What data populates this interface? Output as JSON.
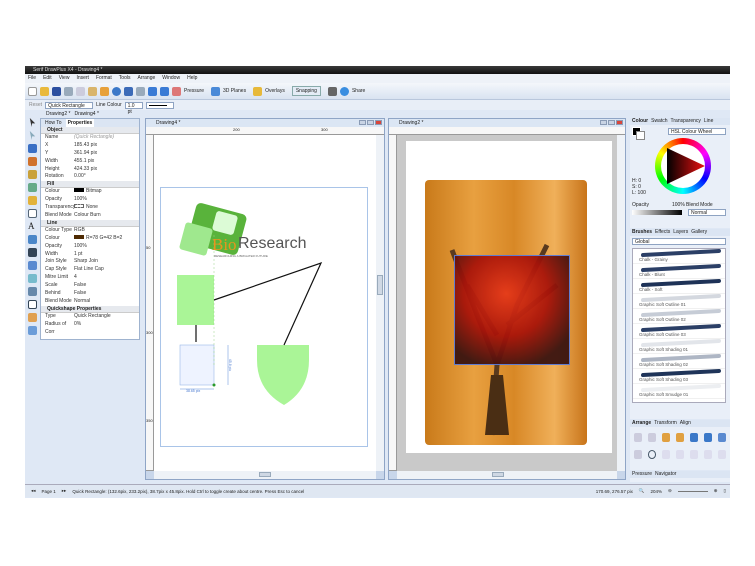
{
  "app": {
    "title": "Serif DrawPlus X4 - Drawing4 *"
  },
  "menu": [
    "File",
    "Edit",
    "View",
    "Insert",
    "Format",
    "Tools",
    "Arrange",
    "Window",
    "Help"
  ],
  "toolbar": {
    "pressure": "Pressure",
    "planes": "3D Planes",
    "overlays": "Overlays",
    "snapping": "Snapping",
    "share": "Share"
  },
  "context": {
    "reset": "Reset",
    "shape": "Quick Rectangle",
    "line_colour": "Line Colour",
    "line_width": "1.0 pt"
  },
  "doc_tabs": [
    "Drawing2 *",
    "Drawing4 *"
  ],
  "props": {
    "tabs": [
      "How To",
      "Properties"
    ],
    "sections": [
      {
        "title": "Object",
        "rows": [
          [
            "Name",
            "(Quick Rectangle)"
          ],
          [
            "X",
            "185.43 pix"
          ],
          [
            "Y",
            "361.94 pix"
          ],
          [
            "Width",
            "455.1 pix"
          ],
          [
            "Height",
            "424.33 pix"
          ],
          [
            "Rotation",
            "0.00°"
          ]
        ]
      },
      {
        "title": "Fill",
        "rows": [
          [
            "Colour",
            "Bitmap"
          ],
          [
            "Opacity",
            "100%"
          ],
          [
            "Transparency",
            "None"
          ],
          [
            "Blend Mode",
            "Colour Burn"
          ]
        ]
      },
      {
        "title": "Line",
        "rows": [
          [
            "Colour Type",
            "RGB"
          ],
          [
            "Colour",
            "R=78 G=42 B=2"
          ],
          [
            "Opacity",
            "100%"
          ],
          [
            "Width",
            "1 pt"
          ],
          [
            "Join Style",
            "Sharp Join"
          ],
          [
            "Cap Style",
            "Flat Line Cap"
          ],
          [
            "Mitre Limit",
            "4"
          ],
          [
            "Scale",
            "False"
          ],
          [
            "Behind",
            "False"
          ],
          [
            "Blend Mode",
            "Normal"
          ]
        ]
      },
      {
        "title": "Quickshape Properties",
        "rows": [
          [
            "Type",
            "Quick Rectangle"
          ],
          [
            "Radius of Corr",
            "0%"
          ]
        ]
      }
    ]
  },
  "doc_left": {
    "title": "Drawing4 *",
    "ruler_top": [
      "200",
      "300"
    ],
    "ruler_left": [
      "50",
      "300",
      "350"
    ],
    "logo_bio": "Bio",
    "logo_research": "Research",
    "logo_tagline": "RESEARCHING A BRIGHTER FUTURE",
    "dim_w": "38.65 pix",
    "dim_h": "45.8 pix"
  },
  "doc_right": {
    "title": "Drawing2 *"
  },
  "colour_panel": {
    "tabs": [
      "Colour",
      "Swatch",
      "Transparency",
      "Line"
    ],
    "mode": "HSL Colour Wheel",
    "h": "H: 0",
    "s": "S: 0",
    "l": "L: 100",
    "opacity_label": "Opacity",
    "opacity": "100%",
    "blend_label": "Blend Mode",
    "blend": "Normal"
  },
  "brushes_panel": {
    "tabs": [
      "Brushes",
      "Effects",
      "Layers",
      "Gallery"
    ],
    "category": "Global",
    "items": [
      {
        "name": "Chalk - Grainy",
        "color": "#2b3f66"
      },
      {
        "name": "Chalk - Blunt",
        "color": "#2b3f66"
      },
      {
        "name": "Chalk - Soft",
        "color": "#1e3257"
      },
      {
        "name": "Graphic Soft Outline 01",
        "color": "#d4d8df"
      },
      {
        "name": "Graphic Soft Outline 02",
        "color": "#c6ccd6"
      },
      {
        "name": "Graphic Soft Outline 03",
        "color": "#2b3f66"
      },
      {
        "name": "Graphic Soft Shading 01",
        "color": "#e2e5ea"
      },
      {
        "name": "Graphic Soft Shading 02",
        "color": "#aeb6c4"
      },
      {
        "name": "Graphic Soft Shading 03",
        "color": "#1f3459"
      },
      {
        "name": "Graphic Soft Smudge 01",
        "color": "#eceef1"
      }
    ]
  },
  "arrange_panel": {
    "tabs": [
      "Arrange",
      "Transform",
      "Align"
    ]
  },
  "bottom_panel": {
    "tabs": [
      "Pressure",
      "Navigator"
    ],
    "zoom": "204%"
  },
  "status": {
    "page": "Page 1",
    "message": "Quick Rectangle: (132.6pix, 233.2pix), 38.7pix x 45.8pix. Hold Ctrl to toggle create about centre. Press Esc to cancel",
    "coords": "170.69, 276.57 pix",
    "zoom": "204%"
  }
}
